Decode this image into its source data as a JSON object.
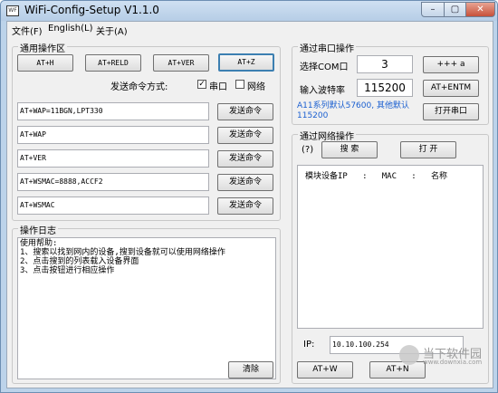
{
  "window": {
    "title": "WiFi-Config-Setup V1.1.0",
    "app_icon": "WF"
  },
  "titlebar_buttons": {
    "minimize": "–",
    "maximize": "▢",
    "close": "✕"
  },
  "menu": {
    "items": [
      "文件(F)",
      "English(L)",
      "关于(A)"
    ]
  },
  "general": {
    "title": "通用操作区",
    "buttons": [
      "AT+H",
      "AT+RELD",
      "AT+VER",
      "AT+Z"
    ],
    "send_mode_label": "发送命令方式:",
    "serial_label": "串口",
    "serial_checked": true,
    "network_label": "网络",
    "network_checked": false,
    "commands": [
      {
        "value": "AT+WAP=11BGN,LPT330",
        "button": "发送命令"
      },
      {
        "value": "AT+WAP",
        "button": "发送命令"
      },
      {
        "value": "AT+VER",
        "button": "发送命令"
      },
      {
        "value": "AT+WSMAC=8888,ACCF2",
        "button": "发送命令"
      },
      {
        "value": "AT+WSMAC",
        "button": "发送命令"
      }
    ]
  },
  "log": {
    "title": "操作日志",
    "lines": [
      "使用帮助:",
      "  1、搜索以找到网内的设备,搜到设备就可以使用网络操作",
      "  2、点击搜到的列表载入设备界面",
      "  3、点击按钮进行相应操作"
    ],
    "clear_button": "清除"
  },
  "serial": {
    "title": "通过串口操作",
    "com_label": "选择COM口",
    "com_value": "3",
    "plus_button": "+++ a",
    "baud_label": "输入波特率",
    "baud_value": "115200",
    "entm_button": "AT+ENTM",
    "hint": "A11系列默认57600, 其他默认115200",
    "open_button": "打开串口"
  },
  "network": {
    "title": "通过网络操作",
    "help": "(?)",
    "search_button": "搜 索",
    "open_button": "打 开",
    "list_header": "模块设备IP   :   MAC   :   名称",
    "ip_label": "IP:",
    "ip_value": "10.10.100.254",
    "atw_button": "AT+W",
    "atn_button": "AT+N"
  },
  "watermark": {
    "text": "当下软件园",
    "url": "www.downxia.com"
  },
  "colors": {
    "hint": "#1a5fd0",
    "titlebar": "#b6cde6",
    "close": "#c7503a"
  }
}
